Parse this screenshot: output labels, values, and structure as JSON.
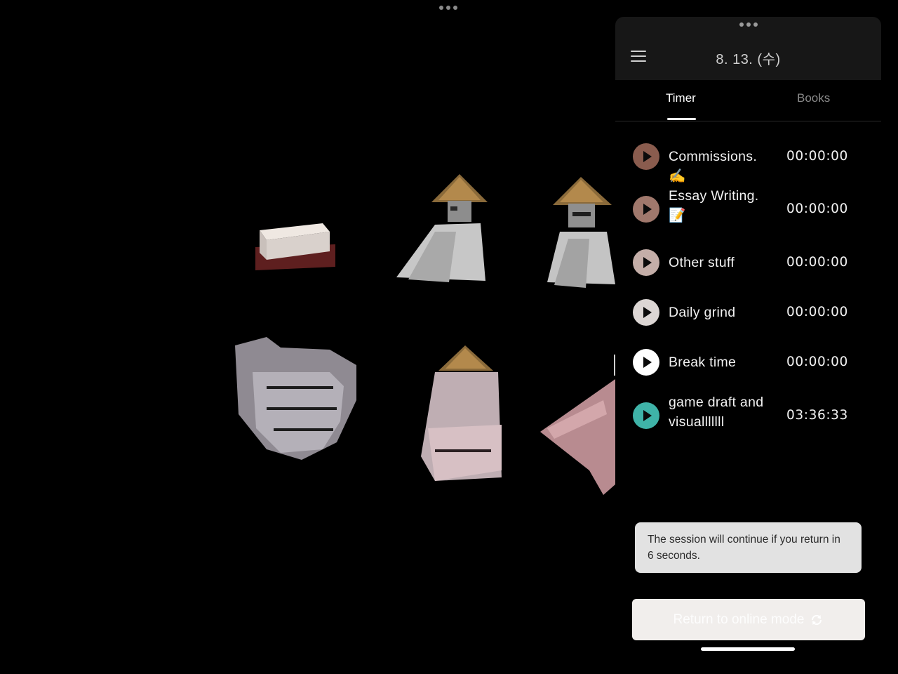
{
  "header": {
    "date": "8. 13. (수)"
  },
  "tabs": [
    {
      "label": "Timer",
      "active": true
    },
    {
      "label": "Books",
      "active": false
    }
  ],
  "tasks": [
    {
      "name": "Commissions. ✍️",
      "time": "00:00:00",
      "color": "#8a5c4e"
    },
    {
      "name": "Essay Writing. 📝",
      "time": "00:00:00",
      "color": "#a0786c"
    },
    {
      "name": "Other stuff",
      "time": "00:00:00",
      "color": "#c4aea8"
    },
    {
      "name": "Daily grind",
      "time": "00:00:00",
      "color": "#dcd6d4"
    },
    {
      "name": "Break time",
      "time": "00:00:00",
      "color": "#ffffff"
    },
    {
      "name": "game draft and visualllllll",
      "time": "03:36:33",
      "color": "#3fb3a8"
    }
  ],
  "toast": {
    "message": "The session will continue if you return in 6 seconds."
  },
  "return_button": {
    "label": "Return to online mode",
    "icon": "sync-icon"
  },
  "icons": {
    "menu": "hamburger-menu-icon",
    "play": "play-icon",
    "more": "more-dots-icon"
  }
}
